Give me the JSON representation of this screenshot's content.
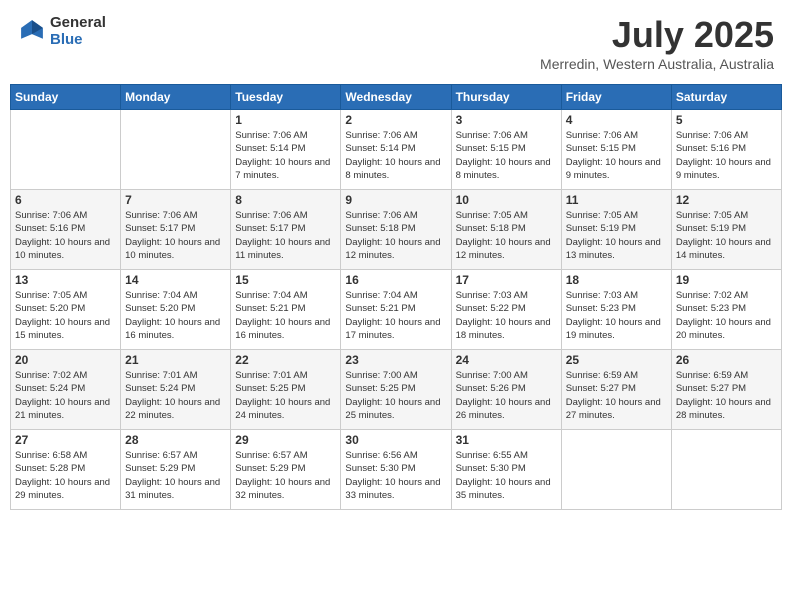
{
  "header": {
    "logo_line1": "General",
    "logo_line2": "Blue",
    "title": "July 2025",
    "subtitle": "Merredin, Western Australia, Australia"
  },
  "days_of_week": [
    "Sunday",
    "Monday",
    "Tuesday",
    "Wednesday",
    "Thursday",
    "Friday",
    "Saturday"
  ],
  "weeks": [
    [
      {
        "day": "",
        "info": ""
      },
      {
        "day": "",
        "info": ""
      },
      {
        "day": "1",
        "info": "Sunrise: 7:06 AM\nSunset: 5:14 PM\nDaylight: 10 hours and 7 minutes."
      },
      {
        "day": "2",
        "info": "Sunrise: 7:06 AM\nSunset: 5:14 PM\nDaylight: 10 hours and 8 minutes."
      },
      {
        "day": "3",
        "info": "Sunrise: 7:06 AM\nSunset: 5:15 PM\nDaylight: 10 hours and 8 minutes."
      },
      {
        "day": "4",
        "info": "Sunrise: 7:06 AM\nSunset: 5:15 PM\nDaylight: 10 hours and 9 minutes."
      },
      {
        "day": "5",
        "info": "Sunrise: 7:06 AM\nSunset: 5:16 PM\nDaylight: 10 hours and 9 minutes."
      }
    ],
    [
      {
        "day": "6",
        "info": "Sunrise: 7:06 AM\nSunset: 5:16 PM\nDaylight: 10 hours and 10 minutes."
      },
      {
        "day": "7",
        "info": "Sunrise: 7:06 AM\nSunset: 5:17 PM\nDaylight: 10 hours and 10 minutes."
      },
      {
        "day": "8",
        "info": "Sunrise: 7:06 AM\nSunset: 5:17 PM\nDaylight: 10 hours and 11 minutes."
      },
      {
        "day": "9",
        "info": "Sunrise: 7:06 AM\nSunset: 5:18 PM\nDaylight: 10 hours and 12 minutes."
      },
      {
        "day": "10",
        "info": "Sunrise: 7:05 AM\nSunset: 5:18 PM\nDaylight: 10 hours and 12 minutes."
      },
      {
        "day": "11",
        "info": "Sunrise: 7:05 AM\nSunset: 5:19 PM\nDaylight: 10 hours and 13 minutes."
      },
      {
        "day": "12",
        "info": "Sunrise: 7:05 AM\nSunset: 5:19 PM\nDaylight: 10 hours and 14 minutes."
      }
    ],
    [
      {
        "day": "13",
        "info": "Sunrise: 7:05 AM\nSunset: 5:20 PM\nDaylight: 10 hours and 15 minutes."
      },
      {
        "day": "14",
        "info": "Sunrise: 7:04 AM\nSunset: 5:20 PM\nDaylight: 10 hours and 16 minutes."
      },
      {
        "day": "15",
        "info": "Sunrise: 7:04 AM\nSunset: 5:21 PM\nDaylight: 10 hours and 16 minutes."
      },
      {
        "day": "16",
        "info": "Sunrise: 7:04 AM\nSunset: 5:21 PM\nDaylight: 10 hours and 17 minutes."
      },
      {
        "day": "17",
        "info": "Sunrise: 7:03 AM\nSunset: 5:22 PM\nDaylight: 10 hours and 18 minutes."
      },
      {
        "day": "18",
        "info": "Sunrise: 7:03 AM\nSunset: 5:23 PM\nDaylight: 10 hours and 19 minutes."
      },
      {
        "day": "19",
        "info": "Sunrise: 7:02 AM\nSunset: 5:23 PM\nDaylight: 10 hours and 20 minutes."
      }
    ],
    [
      {
        "day": "20",
        "info": "Sunrise: 7:02 AM\nSunset: 5:24 PM\nDaylight: 10 hours and 21 minutes."
      },
      {
        "day": "21",
        "info": "Sunrise: 7:01 AM\nSunset: 5:24 PM\nDaylight: 10 hours and 22 minutes."
      },
      {
        "day": "22",
        "info": "Sunrise: 7:01 AM\nSunset: 5:25 PM\nDaylight: 10 hours and 24 minutes."
      },
      {
        "day": "23",
        "info": "Sunrise: 7:00 AM\nSunset: 5:25 PM\nDaylight: 10 hours and 25 minutes."
      },
      {
        "day": "24",
        "info": "Sunrise: 7:00 AM\nSunset: 5:26 PM\nDaylight: 10 hours and 26 minutes."
      },
      {
        "day": "25",
        "info": "Sunrise: 6:59 AM\nSunset: 5:27 PM\nDaylight: 10 hours and 27 minutes."
      },
      {
        "day": "26",
        "info": "Sunrise: 6:59 AM\nSunset: 5:27 PM\nDaylight: 10 hours and 28 minutes."
      }
    ],
    [
      {
        "day": "27",
        "info": "Sunrise: 6:58 AM\nSunset: 5:28 PM\nDaylight: 10 hours and 29 minutes."
      },
      {
        "day": "28",
        "info": "Sunrise: 6:57 AM\nSunset: 5:29 PM\nDaylight: 10 hours and 31 minutes."
      },
      {
        "day": "29",
        "info": "Sunrise: 6:57 AM\nSunset: 5:29 PM\nDaylight: 10 hours and 32 minutes."
      },
      {
        "day": "30",
        "info": "Sunrise: 6:56 AM\nSunset: 5:30 PM\nDaylight: 10 hours and 33 minutes."
      },
      {
        "day": "31",
        "info": "Sunrise: 6:55 AM\nSunset: 5:30 PM\nDaylight: 10 hours and 35 minutes."
      },
      {
        "day": "",
        "info": ""
      },
      {
        "day": "",
        "info": ""
      }
    ]
  ]
}
